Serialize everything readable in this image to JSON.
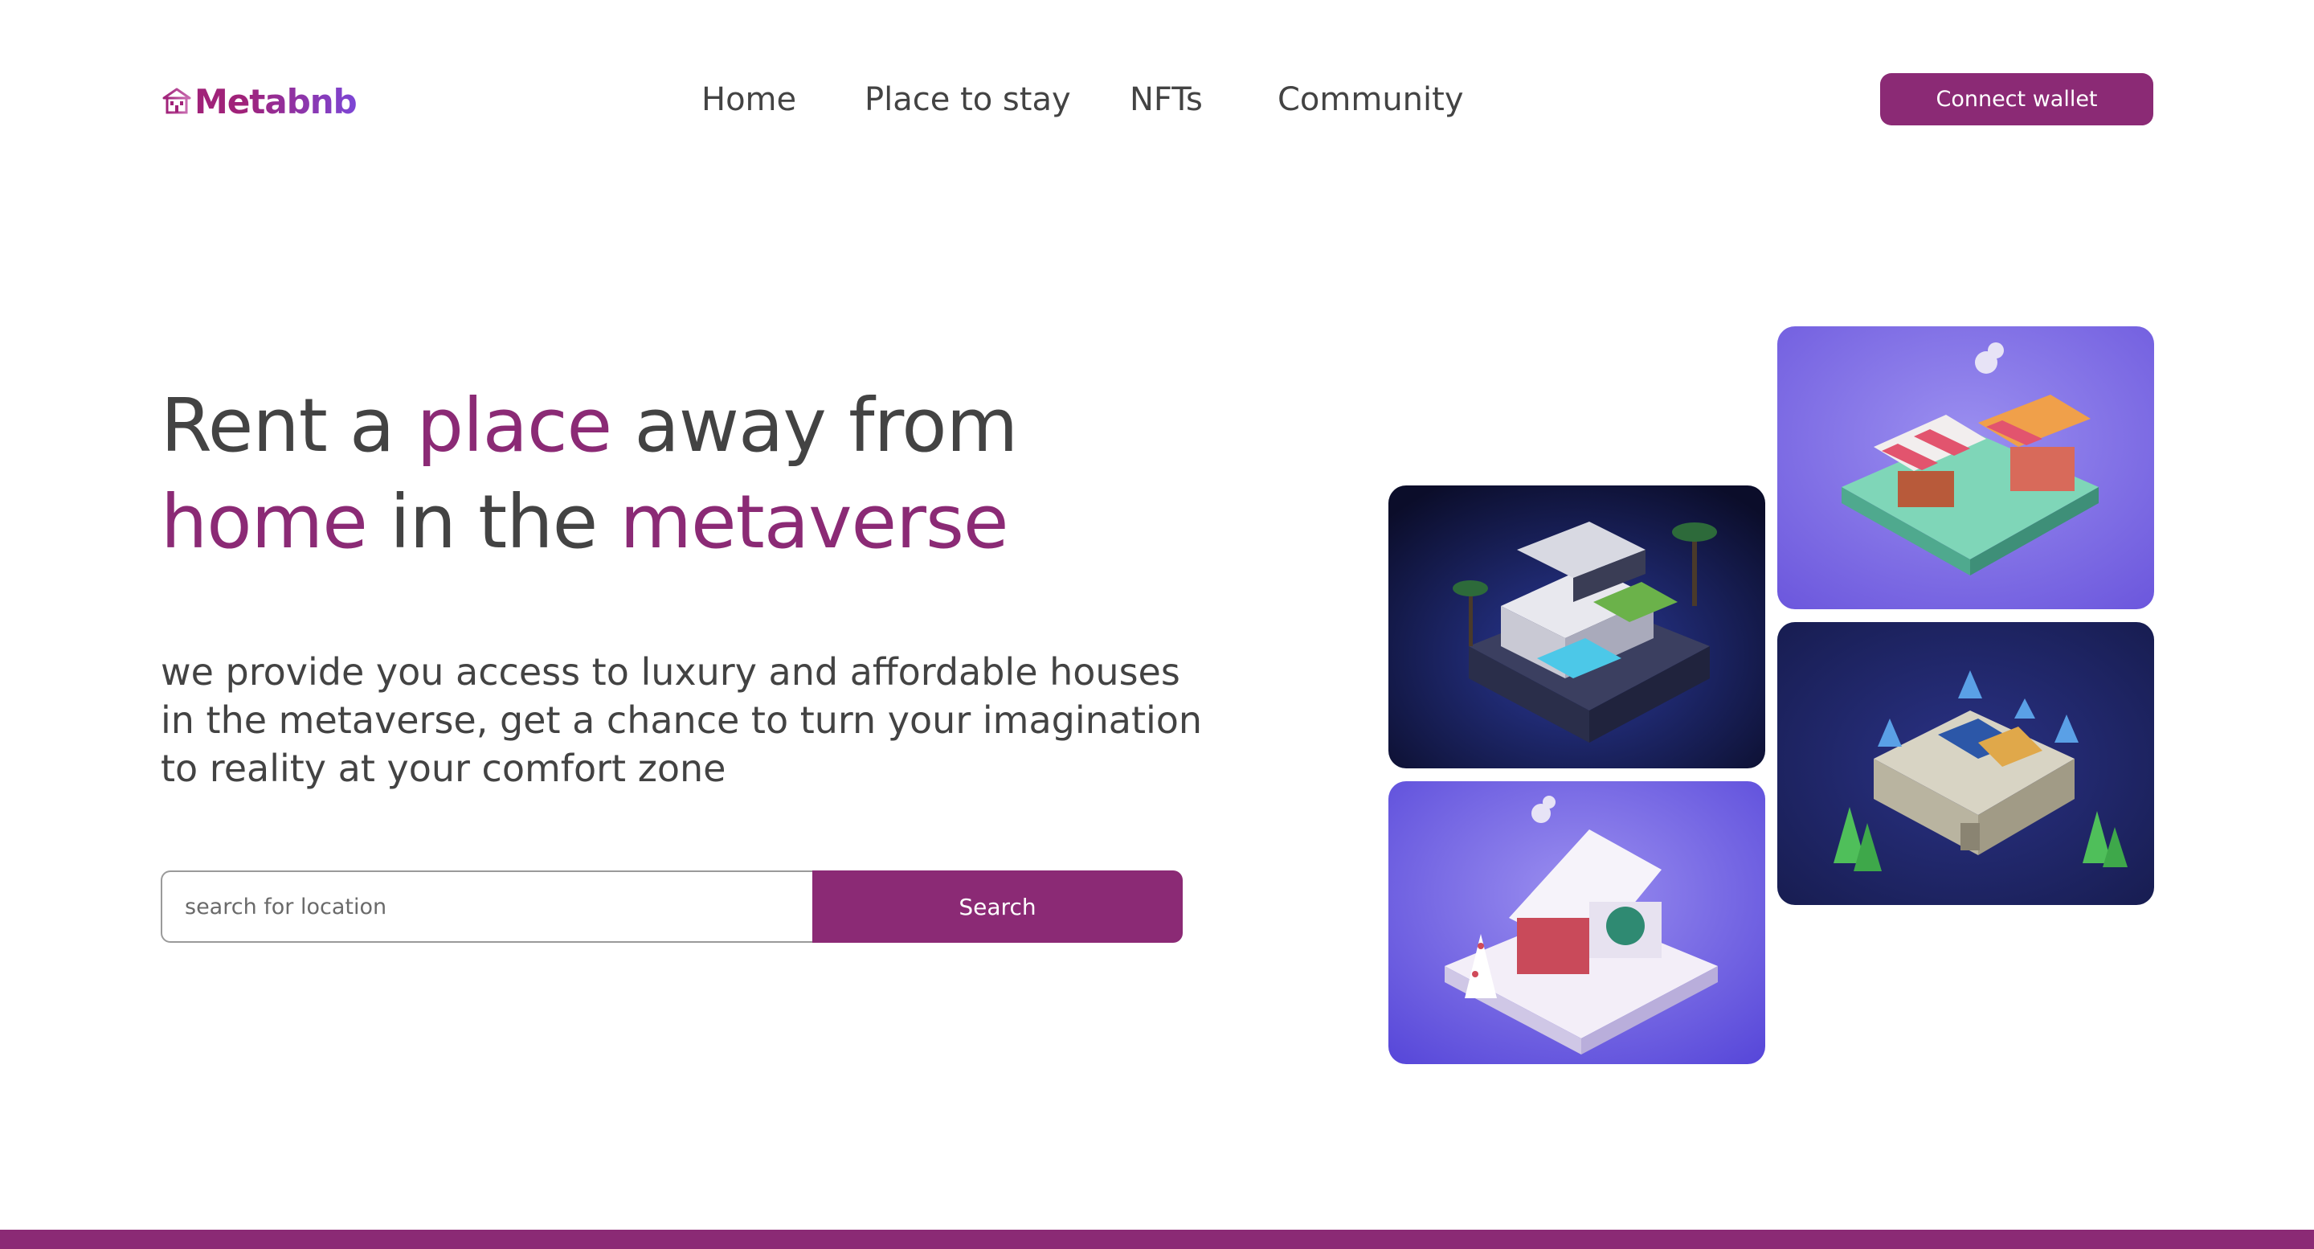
{
  "brand": {
    "name": "Metabnb",
    "icon": "house-icon"
  },
  "nav": {
    "items": [
      "Home",
      "Place to stay",
      "NFTs",
      "Community"
    ]
  },
  "header": {
    "connect_label": "Connect wallet"
  },
  "hero": {
    "headline": {
      "w1": "Rent a ",
      "w2": "place",
      "w3": " away from",
      "w4": "home",
      "w5": " in the ",
      "w6": "metaverse"
    },
    "subtitle": "we provide you access to luxury and affordable houses in the metaverse, get a chance to turn your imagination to reality at your comfort zone"
  },
  "search": {
    "placeholder": "search for location",
    "button_label": "Search"
  },
  "gallery": {
    "images": [
      "modern-villa-image",
      "market-stall-image",
      "castle-image",
      "snow-cottage-image"
    ]
  },
  "colors": {
    "accent": "#8b2a75",
    "text": "#434343",
    "logo_gradient_end": "#7c46d6"
  }
}
